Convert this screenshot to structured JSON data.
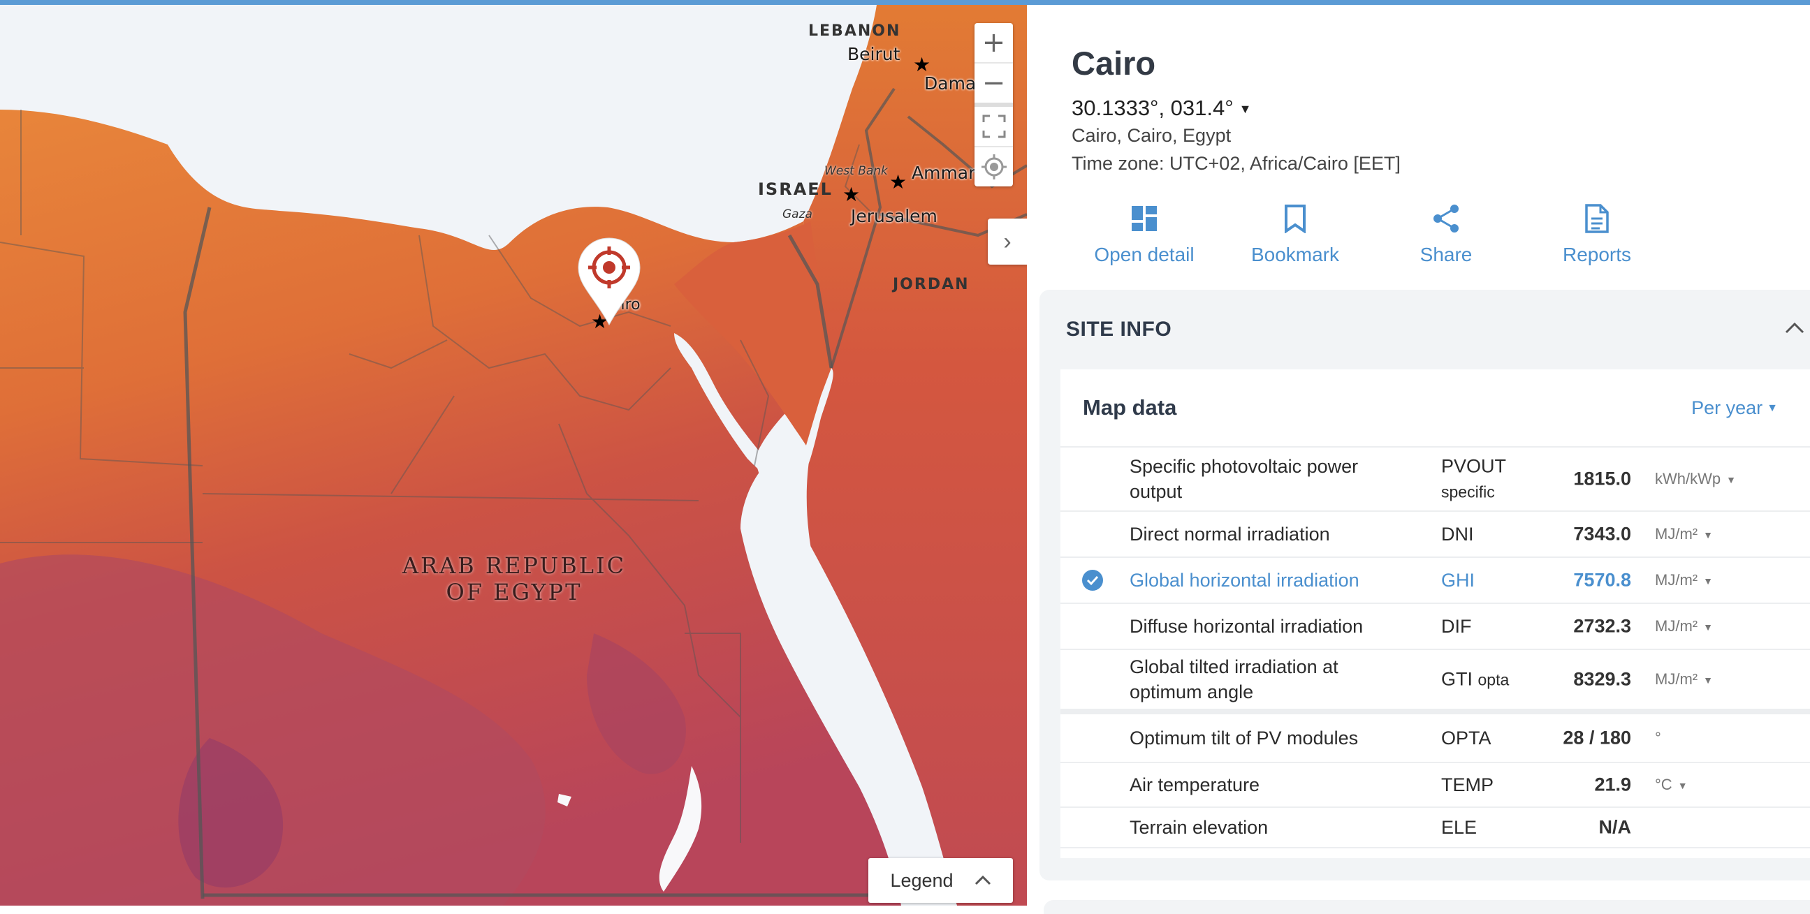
{
  "map": {
    "labels": {
      "lebanon": "LEBANON",
      "beirut": "Beirut",
      "damascus": "Dama",
      "israel": "ISRAEL",
      "west_bank": "West Bank",
      "gaza": "Gaza",
      "amman": "Amman",
      "jerusalem": "Jerusalem",
      "jordan": "JORDAN",
      "cairo": "airo",
      "egypt_line1": "ARAB REPUBLIC",
      "egypt_line2": "OF EGYPT"
    },
    "controls": {
      "zoom_in": "+",
      "zoom_out": "−",
      "fullscreen_icon": "fullscreen-icon",
      "locate_icon": "locate-icon",
      "collapse": "›"
    },
    "legend": {
      "label": "Legend",
      "chevron": "⌃"
    }
  },
  "site": {
    "title": "Cairo",
    "coords": "30.1333°, 031.4°",
    "address": "Cairo, Cairo, Egypt",
    "timezone": "Time zone: UTC+02, Africa/Cairo [EET]"
  },
  "actions": [
    {
      "label": "Open detail",
      "icon": "dashboard-icon"
    },
    {
      "label": "Bookmark",
      "icon": "bookmark-icon"
    },
    {
      "label": "Share",
      "icon": "share-icon"
    },
    {
      "label": "Reports",
      "icon": "document-icon"
    }
  ],
  "site_info": {
    "title": "SITE INFO",
    "map_data_title": "Map data",
    "period": "Per year",
    "rows": [
      {
        "name": "Specific photovoltaic power output",
        "code": "PVOUT",
        "code_sub": "specific",
        "value": "1815.0",
        "unit": "kWh/kWp",
        "checked": false
      },
      {
        "name": "Direct normal irradiation",
        "code": "DNI",
        "code_sub": "",
        "value": "7343.0",
        "unit": "MJ/m²",
        "checked": false
      },
      {
        "name": "Global horizontal irradiation",
        "code": "GHI",
        "code_sub": "",
        "value": "7570.8",
        "unit": "MJ/m²",
        "checked": true
      },
      {
        "name": "Diffuse horizontal irradiation",
        "code": "DIF",
        "code_sub": "",
        "value": "2732.3",
        "unit": "MJ/m²",
        "checked": false
      },
      {
        "name": "Global tilted irradiation at optimum angle",
        "code": "GTI",
        "code_sub": "opta",
        "value": "8329.3",
        "unit": "MJ/m²",
        "checked": false
      },
      {
        "name": "Optimum tilt of PV modules",
        "code": "OPTA",
        "code_sub": "",
        "value": "28 /  180",
        "unit": "°",
        "checked": false
      },
      {
        "name": "Air temperature",
        "code": "TEMP",
        "code_sub": "",
        "value": "21.9",
        "unit": "°C",
        "checked": false
      },
      {
        "name": "Terrain elevation",
        "code": "ELE",
        "code_sub": "",
        "value": "N/A",
        "unit": "",
        "checked": false
      }
    ]
  }
}
